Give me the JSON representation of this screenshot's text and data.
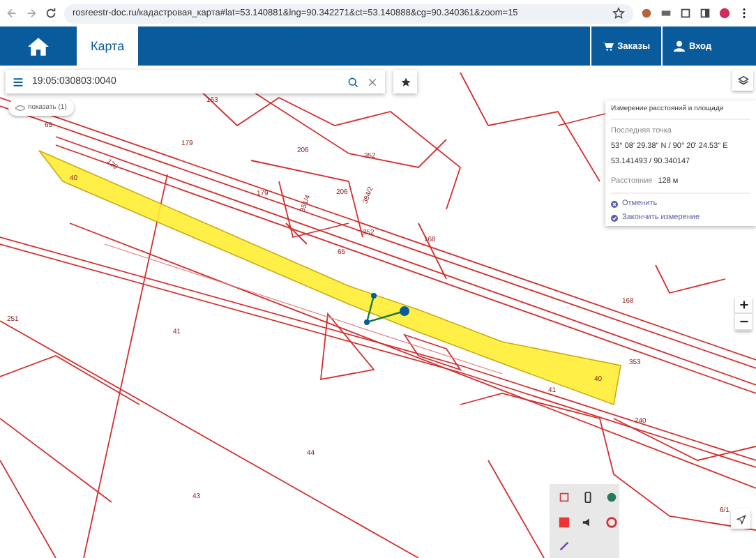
{
  "browser": {
    "url": "rosreestr-doc.ru/кадастровая_карта#lat=53.140881&lng=90.342271&ct=53.140888&cg=90.340361&zoom=15"
  },
  "nav": {
    "tabs": [
      {
        "kind": "home",
        "selected": false
      },
      {
        "kind": "text",
        "label": "Карта",
        "selected": true
      }
    ],
    "right": [
      {
        "kind": "cart",
        "label": "Заказы"
      },
      {
        "kind": "user",
        "label": "Вход"
      }
    ]
  },
  "search": {
    "value": "19:05:030803:0040"
  },
  "filter_chip": "показать (1)",
  "measure_panel": {
    "title": "Измерение расстояний и площади",
    "last_point_label": "Последняя точка",
    "dms": "53° 08' 29.38\" N / 90° 20' 24.53\" E",
    "decimal": "53.141493 / 90.340147",
    "distance_label": "Расстояние",
    "distance": "128 м",
    "actions": [
      {
        "kind": "cancel",
        "label": "Отменить"
      },
      {
        "kind": "finish",
        "label": "Закончить измерение"
      }
    ]
  },
  "map": {
    "labels": [
      "163",
      "65",
      "179",
      "206",
      "352",
      "179",
      "351/4",
      "206",
      "384/2",
      "352",
      "65",
      "168",
      "168",
      "353",
      "41",
      "40",
      "41",
      "251",
      "44",
      "43",
      "240",
      "6/1",
      "120",
      "40"
    ]
  }
}
